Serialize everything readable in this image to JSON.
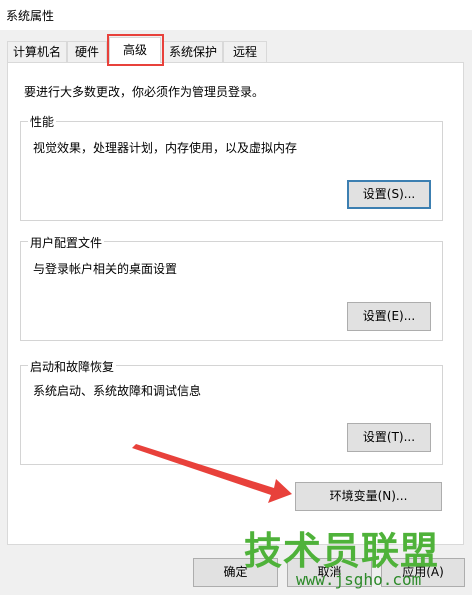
{
  "window": {
    "title": "系统属性"
  },
  "tabs": [
    {
      "label": "计算机名"
    },
    {
      "label": "硬件"
    },
    {
      "label": "高级"
    },
    {
      "label": "系统保护"
    },
    {
      "label": "远程"
    }
  ],
  "notice": "要进行大多数更改，你必须作为管理员登录。",
  "groups": {
    "performance": {
      "label": "性能",
      "desc": "视觉效果，处理器计划，内存使用，以及虚拟内存",
      "button": "设置(S)..."
    },
    "profiles": {
      "label": "用户配置文件",
      "desc": "与登录帐户相关的桌面设置",
      "button": "设置(E)..."
    },
    "startup": {
      "label": "启动和故障恢复",
      "desc": "系统启动、系统故障和调试信息",
      "button": "设置(T)..."
    }
  },
  "env_button": "环境变量(N)...",
  "footer": {
    "ok": "确定",
    "cancel": "取消",
    "apply": "应用(A)"
  },
  "watermark": {
    "text": "技术员联盟",
    "url": "www.jsgho.com"
  },
  "colors": {
    "highlight": "#e8413b",
    "arrow": "#e8413b",
    "watermark": "#4fb23a"
  }
}
